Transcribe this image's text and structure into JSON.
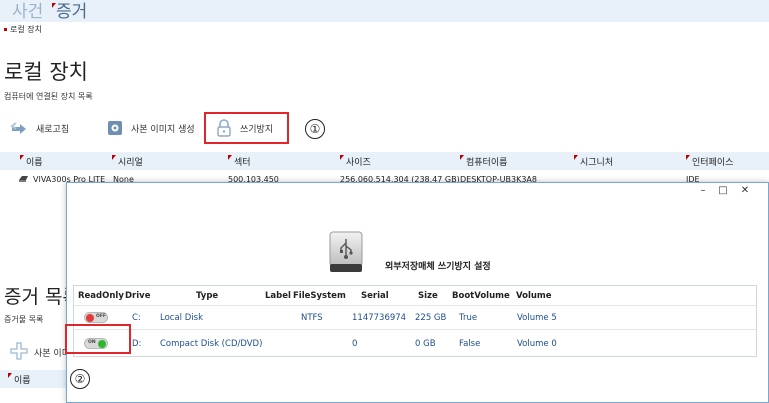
{
  "tabs": [
    {
      "label": "사건"
    },
    {
      "label": "증거"
    }
  ],
  "breadcrumb": "로컬 장치",
  "page": {
    "title": "로컬 장치",
    "subtitle": "컴퓨터에 연결된 장치 목록"
  },
  "toolbar": {
    "refresh_label": "새로고침",
    "image_label": "사본 이미지 생성",
    "write_protect_label": "쓰기방지",
    "callout_1": "①"
  },
  "devices_table": {
    "columns": [
      "이름",
      "시리얼",
      "섹터",
      "사이즈",
      "컴퓨터이름",
      "시그니처",
      "인터페이스"
    ],
    "rows": [
      {
        "name": "VIVA300s Pro LITE",
        "serial": "None",
        "sector": "500,103,450",
        "size": "256,060,514,304 (238.47 GB)",
        "computer": "DESKTOP-UB3K3A8",
        "signature": "",
        "interface": "IDE"
      }
    ]
  },
  "section2": {
    "title": "증거 목록",
    "subtitle": "증거물 목록",
    "button_label": "사본 이미지",
    "columns": [
      "이름"
    ],
    "callout_2": "②"
  },
  "dialog": {
    "window_controls": {
      "minimize": "–",
      "maximize": "□",
      "close": "✕"
    },
    "title": "외부저장매체 쓰기방지 설정",
    "columns": [
      "ReadOnly",
      "Drive",
      "Type",
      "Label",
      "FileSystem",
      "Serial",
      "Size",
      "BootVolume",
      "Volume"
    ],
    "rows": [
      {
        "readonly": "OFF",
        "drive": "C:",
        "type": "Local Disk",
        "label": "",
        "filesystem": "NTFS",
        "serial": "1147736974",
        "size": "225 GB",
        "bootvolume": "True",
        "volume": "Volume 5"
      },
      {
        "readonly": "ON",
        "drive": "D:",
        "type": "Compact Disk (CD/DVD)",
        "label": "",
        "filesystem": "",
        "serial": "0",
        "size": "0 GB",
        "bootvolume": "False",
        "volume": "Volume 0"
      }
    ]
  },
  "colors": {
    "accent": "#e0262a",
    "header_bg": "#e8f1fa",
    "link_text": "#1f4e8c",
    "toggle_on": "#2fb52f",
    "toggle_off": "#e23a3a"
  }
}
